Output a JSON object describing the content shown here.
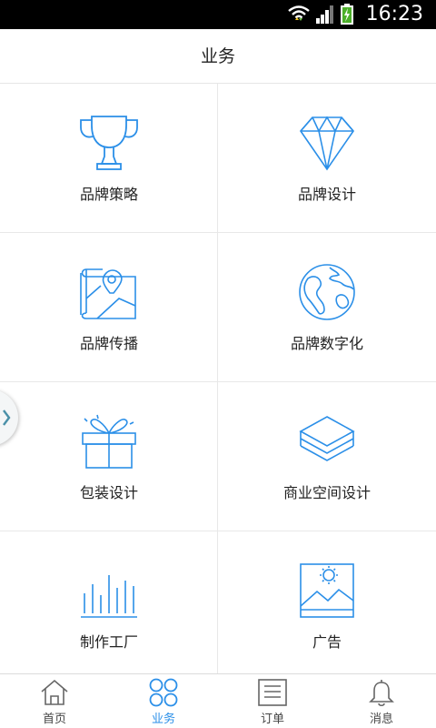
{
  "status_bar": {
    "time": "16:23"
  },
  "header": {
    "title": "业务"
  },
  "services": [
    {
      "label": "品牌策略",
      "icon": "trophy-icon"
    },
    {
      "label": "品牌设计",
      "icon": "diamond-icon"
    },
    {
      "label": "品牌传播",
      "icon": "map-pin-icon"
    },
    {
      "label": "品牌数字化",
      "icon": "globe-icon"
    },
    {
      "label": "包装设计",
      "icon": "gift-box-icon"
    },
    {
      "label": "商业空间设计",
      "icon": "layers-icon"
    },
    {
      "label": "制作工厂",
      "icon": "bar-lines-icon"
    },
    {
      "label": "广告",
      "icon": "image-icon"
    }
  ],
  "bottom_nav": [
    {
      "label": "首页",
      "icon": "home-icon",
      "active": false
    },
    {
      "label": "业务",
      "icon": "four-circles-icon",
      "active": true
    },
    {
      "label": "订单",
      "icon": "list-icon",
      "active": false
    },
    {
      "label": "消息",
      "icon": "bell-icon",
      "active": false
    }
  ],
  "colors": {
    "accent": "#2b8fe8",
    "text": "#222222",
    "divider": "#e8e8e8"
  }
}
